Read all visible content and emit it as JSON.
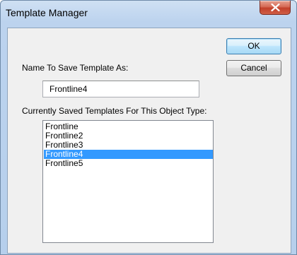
{
  "window": {
    "title": "Template Manager"
  },
  "buttons": {
    "ok_label": "OK",
    "cancel_label": "Cancel"
  },
  "name_field": {
    "label": "Name To Save Template As:",
    "value": "Frontline4"
  },
  "templates_list": {
    "label": "Currently Saved Templates For This Object Type:",
    "items": [
      {
        "label": "Frontline",
        "selected": false
      },
      {
        "label": "Frontline2",
        "selected": false
      },
      {
        "label": "Frontline3",
        "selected": false
      },
      {
        "label": "Frontline4",
        "selected": true
      },
      {
        "label": "Frontline5",
        "selected": false
      }
    ]
  },
  "colors": {
    "selection": "#3399ff",
    "close_button": "#c2402a"
  },
  "icons": {
    "close": "close-icon"
  }
}
